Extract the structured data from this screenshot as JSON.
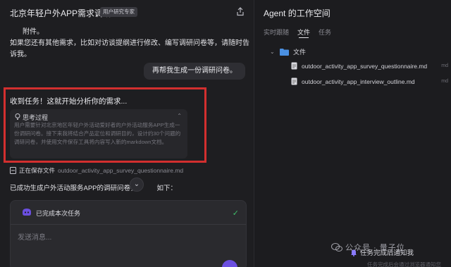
{
  "header": {
    "title": "北京年轻户外APP需求调研",
    "badge": "用户研究专家"
  },
  "chat": {
    "attachment_text": "附件。",
    "assistant_intro": "如果您还有其他需求，比如对访谈提纲进行修改、编写调研问卷等，请随时告诉我。",
    "user_message": "再帮我生成一份调研问卷。",
    "received_text": "收到任务！这就开始分析你的需求...",
    "thinking": {
      "title": "思考过程",
      "body": "用户需要针对北京地区年轻户外活动爱好者的户外活动服务APP生成一份调研问卷。接下来我将结合产品定位和调研目的，设计约30个问题的调研问卷，并使用文件保存工具将内容写入新的markdown文档。"
    },
    "saving": {
      "label": "正在保存文件",
      "filename": "outdoor_activity_app_survey_questionnaire.md"
    },
    "success_text": "已成功生成户外活动服务APP的调研问卷，",
    "success_text_tail": "如下：",
    "scroll_down_glyph": "⌄"
  },
  "composer": {
    "task_status": "已完成本次任务",
    "placeholder": "发送消息..."
  },
  "workspace": {
    "title": "Agent 的工作空间",
    "tabs": [
      "实时跟随",
      "文件",
      "任务"
    ],
    "active_tab": "文件",
    "folder": "文件",
    "files": [
      "outdoor_activity_app_survey_questionnaire.md",
      "outdoor_activity_app_interview_outline.md"
    ],
    "file_tags": [
      "md",
      "md"
    ]
  },
  "notify": {
    "label": "任务完成后通知我",
    "sub": "任务完成后会通过浏览器通知您"
  },
  "watermark": {
    "text": "公众号 · 量子位"
  },
  "colors": {
    "highlight_border": "#d32f2f",
    "success_check": "#3fbf6a",
    "folder_blue": "#4a90e2",
    "accent_purple": "#6b4fe0"
  }
}
